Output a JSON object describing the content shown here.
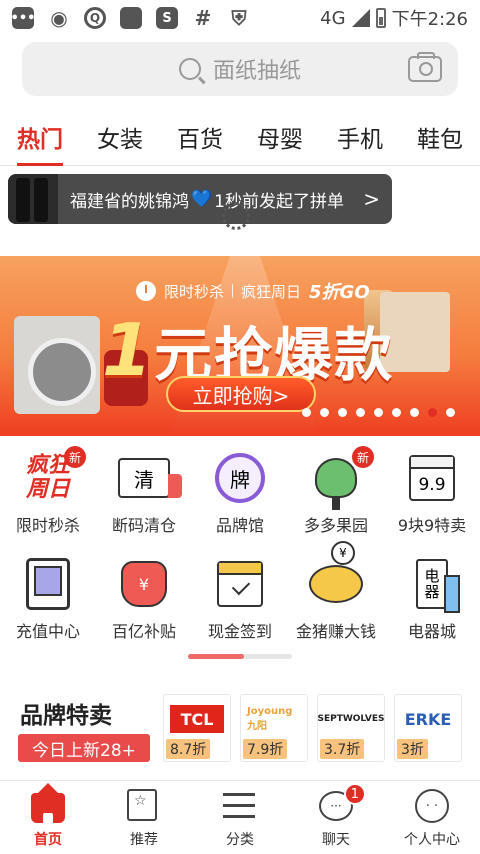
{
  "status_bar": {
    "icons": [
      "message-icon",
      "weibo-icon",
      "q-app-icon",
      "app-icon",
      "s-app-icon",
      "hash-icon",
      "vpn-icon"
    ],
    "q_glyph": "Q",
    "s_glyph": "S",
    "hash_glyph": "#",
    "network": "4G",
    "time": "下午2:26"
  },
  "search": {
    "placeholder": "面纸抽纸"
  },
  "tabs": [
    {
      "label": "热门",
      "active": true
    },
    {
      "label": "女装"
    },
    {
      "label": "百货"
    },
    {
      "label": "母婴"
    },
    {
      "label": "手机"
    },
    {
      "label": "鞋包"
    }
  ],
  "notice": {
    "text_before": "福建省的姚锦鸿",
    "heart": "💙",
    "text_after": "1秒前发起了拼单",
    "arrow": ">"
  },
  "banner": {
    "flash_label": "限时秒杀",
    "crazy_weekend": "疯狂周日",
    "discount_badge": "5折GO",
    "title_number": "1",
    "title_text": "元抢爆款",
    "cta": "立即抢购>",
    "slide_count": 9,
    "active_slide": 8
  },
  "grid": {
    "items": [
      {
        "label": "限时秒杀",
        "icon": "flash-sale-icon",
        "glyph": "疯狂周日",
        "new": true
      },
      {
        "label": "断码清仓",
        "icon": "clearance-truck-icon",
        "glyph": "清"
      },
      {
        "label": "品牌馆",
        "icon": "brand-medal-icon",
        "glyph": "牌"
      },
      {
        "label": "多多果园",
        "icon": "orchard-tree-icon",
        "new": true
      },
      {
        "label": "9块9特卖",
        "icon": "nine-nine-calendar-icon",
        "glyph": "9.9"
      },
      {
        "label": "充值中心",
        "icon": "recharge-tablet-icon"
      },
      {
        "label": "百亿补贴",
        "icon": "subsidy-bag-icon",
        "glyph": "¥"
      },
      {
        "label": "现金签到",
        "icon": "checkin-calendar-icon"
      },
      {
        "label": "金猪赚大钱",
        "icon": "golden-pig-icon"
      },
      {
        "label": "电器城",
        "icon": "appliance-icon",
        "glyph": "电器"
      }
    ],
    "new_badge": "新",
    "scroll_progress": 0.54
  },
  "brand_sale": {
    "title": "品牌特卖",
    "new_today": "今日上新28+",
    "brands": [
      {
        "name": "TCL",
        "discount": "8.7折"
      },
      {
        "name": "Joyoung 九阳",
        "discount": "7.9折"
      },
      {
        "name": "SEPTWOLVES",
        "discount": "3.7折"
      },
      {
        "name": "ERKE",
        "discount": "3折"
      }
    ]
  },
  "bottom_nav": {
    "items": [
      {
        "label": "首页",
        "icon": "home-icon",
        "active": true
      },
      {
        "label": "推荐",
        "icon": "recommend-icon"
      },
      {
        "label": "分类",
        "icon": "category-icon"
      },
      {
        "label": "聊天",
        "icon": "chat-icon",
        "badge": "1"
      },
      {
        "label": "个人中心",
        "icon": "profile-icon",
        "glyph": "· ·"
      }
    ]
  },
  "colors": {
    "accent": "#e02e24",
    "banner_orange": "#f57d3e"
  }
}
